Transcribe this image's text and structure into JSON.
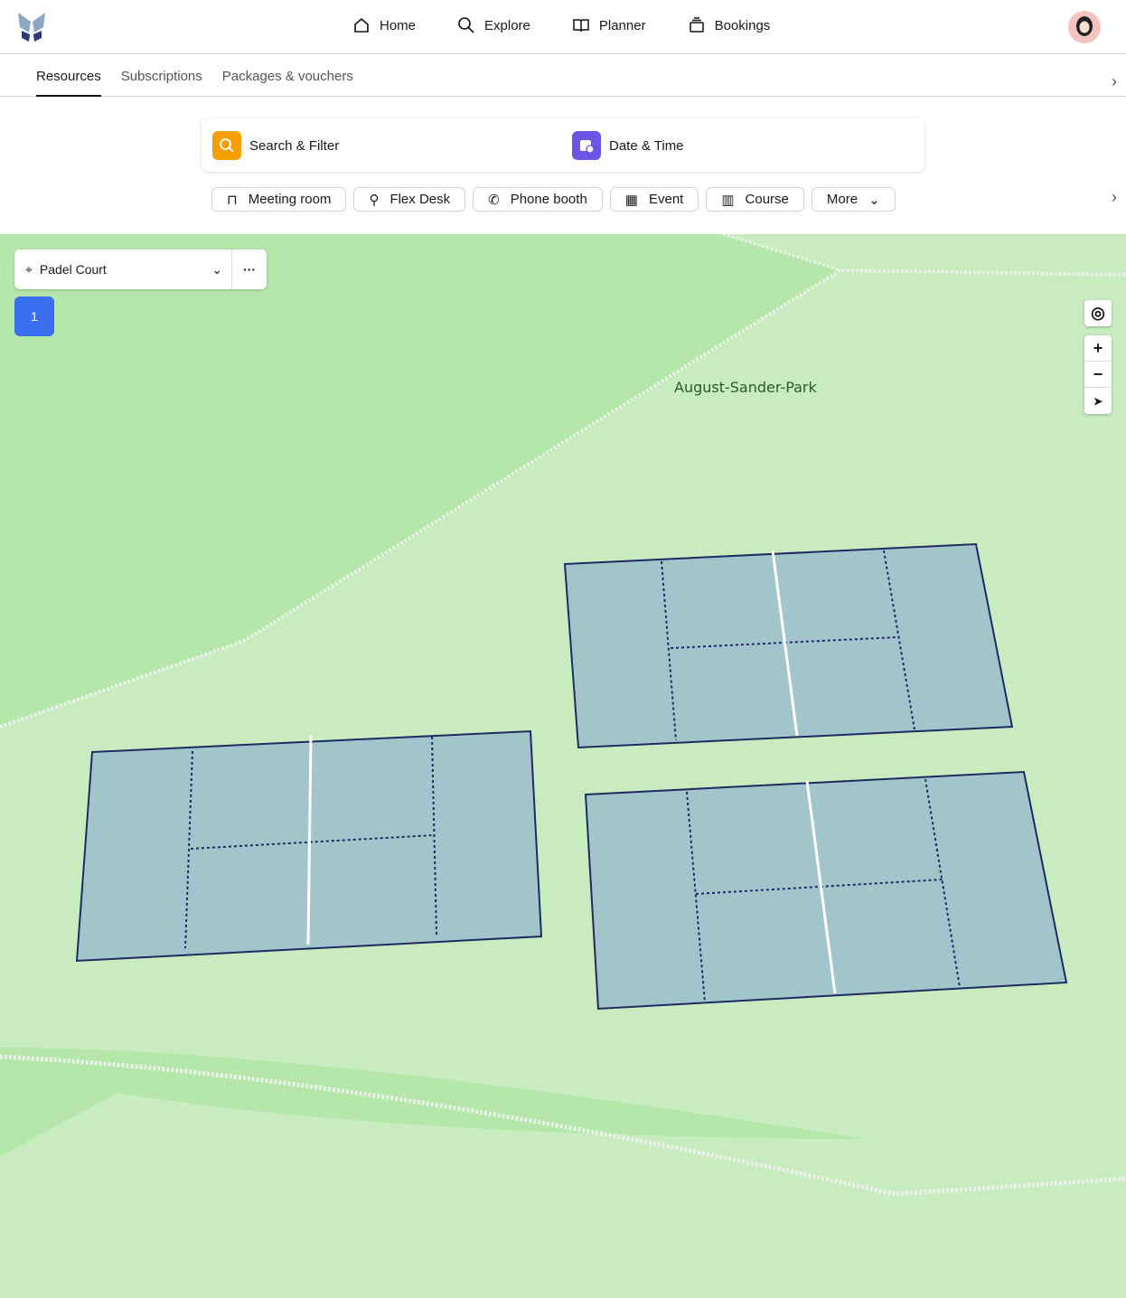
{
  "nav": {
    "items": [
      {
        "label": "Home",
        "icon": "home-icon"
      },
      {
        "label": "Explore",
        "icon": "search-icon"
      },
      {
        "label": "Planner",
        "icon": "book-icon"
      },
      {
        "label": "Bookings",
        "icon": "stack-icon"
      }
    ]
  },
  "tabs": [
    "Resources",
    "Subscriptions",
    "Packages & vouchers"
  ],
  "search": {
    "filter_label": "Search & Filter",
    "date_label": "Date & Time",
    "filter_color": "#f5a000",
    "date_color": "#6b55e6"
  },
  "chips": [
    "Meeting room",
    "Flex Desk",
    "Phone booth",
    "Event",
    "Course",
    "More"
  ],
  "map": {
    "location": "Padel Court",
    "count": "1",
    "park_label": "August-Sander-Park",
    "zoom_in": "+",
    "zoom_out": "−"
  }
}
